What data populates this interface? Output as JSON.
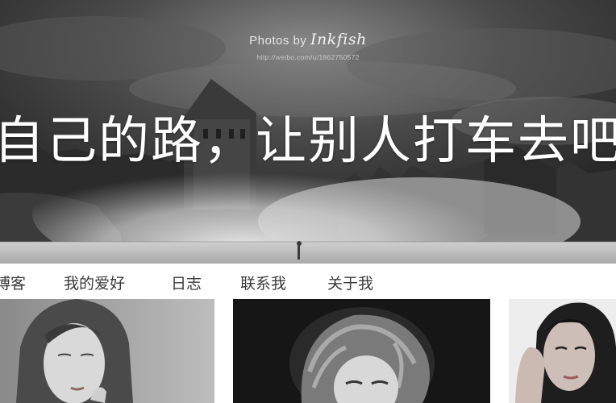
{
  "hero": {
    "credit_prefix": "Photos by",
    "credit_signature": "Inkfish",
    "credit_url": "http://weibo.com/u/1862750572",
    "headline": "自己的路，让别人打车去吧"
  },
  "nav": {
    "items": [
      {
        "label": "博客"
      },
      {
        "label": "我的爱好"
      },
      {
        "label": "日志"
      },
      {
        "label": "联系我"
      },
      {
        "label": "关于我"
      }
    ]
  },
  "gallery": {
    "photos": [
      {
        "subject": "portrait-woman-hand-on-chin"
      },
      {
        "subject": "portrait-curly-blonde-woman"
      },
      {
        "subject": "portrait-woman-hand-at-face"
      }
    ]
  }
}
